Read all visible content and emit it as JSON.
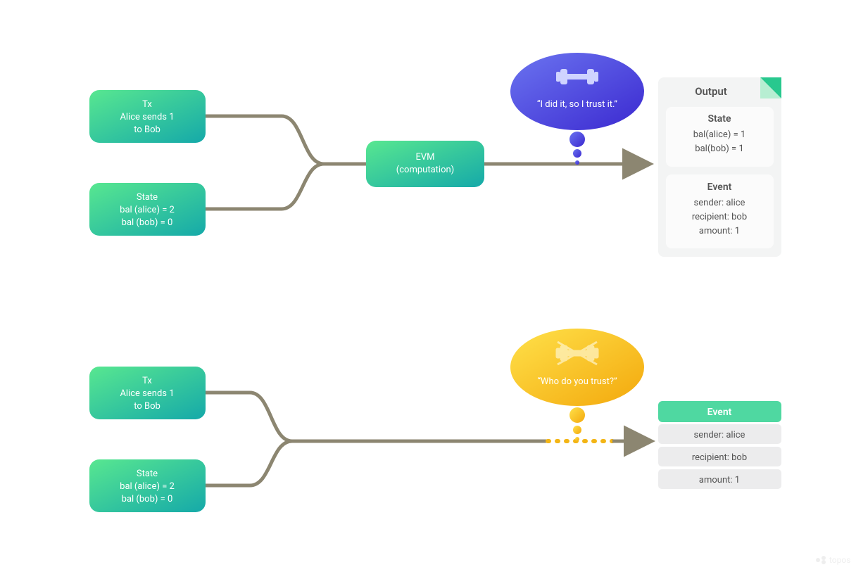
{
  "top": {
    "tx": {
      "title": "Tx",
      "line1": "Alice sends 1",
      "line2": "to Bob"
    },
    "state": {
      "title": "State",
      "line1": "bal (alice) = 2",
      "line2": "bal (bob) = 0"
    },
    "evm": {
      "line1": "EVM",
      "line2": "(computation)"
    },
    "bubble_text": "“I did it, so I trust it.”",
    "output_title": "Output",
    "output_state": {
      "title": "State",
      "line1": "bal(alice) = 1",
      "line2": "bal(bob) = 1"
    },
    "output_event": {
      "title": "Event",
      "line1": "sender: alice",
      "line2": "recipient: bob",
      "line3": "amount: 1"
    }
  },
  "bottom": {
    "tx": {
      "title": "Tx",
      "line1": "Alice sends 1",
      "line2": "to Bob"
    },
    "state": {
      "title": "State",
      "line1": "bal (alice) = 2",
      "line2": "bal (bob) = 0"
    },
    "bubble_text": "“Who do you trust?”",
    "event_title": "Event",
    "event_rows": [
      "sender: alice",
      "recipient: bob",
      "amount: 1"
    ]
  },
  "watermark": "topos",
  "colors": {
    "box_g1": "#58e790",
    "box_g2": "#15a9a9",
    "bubble_blue1": "#6b74f0",
    "bubble_blue2": "#3b29d0",
    "bubble_yellow1": "#ffe14a",
    "bubble_yellow2": "#f3a80c",
    "connector": "#8c8671",
    "output_bg": "#f3f4f4",
    "output_card": "#fbfbfb",
    "event_header": "#4fd8a1",
    "event_row": "#ececed",
    "fold": "#28c88e"
  }
}
